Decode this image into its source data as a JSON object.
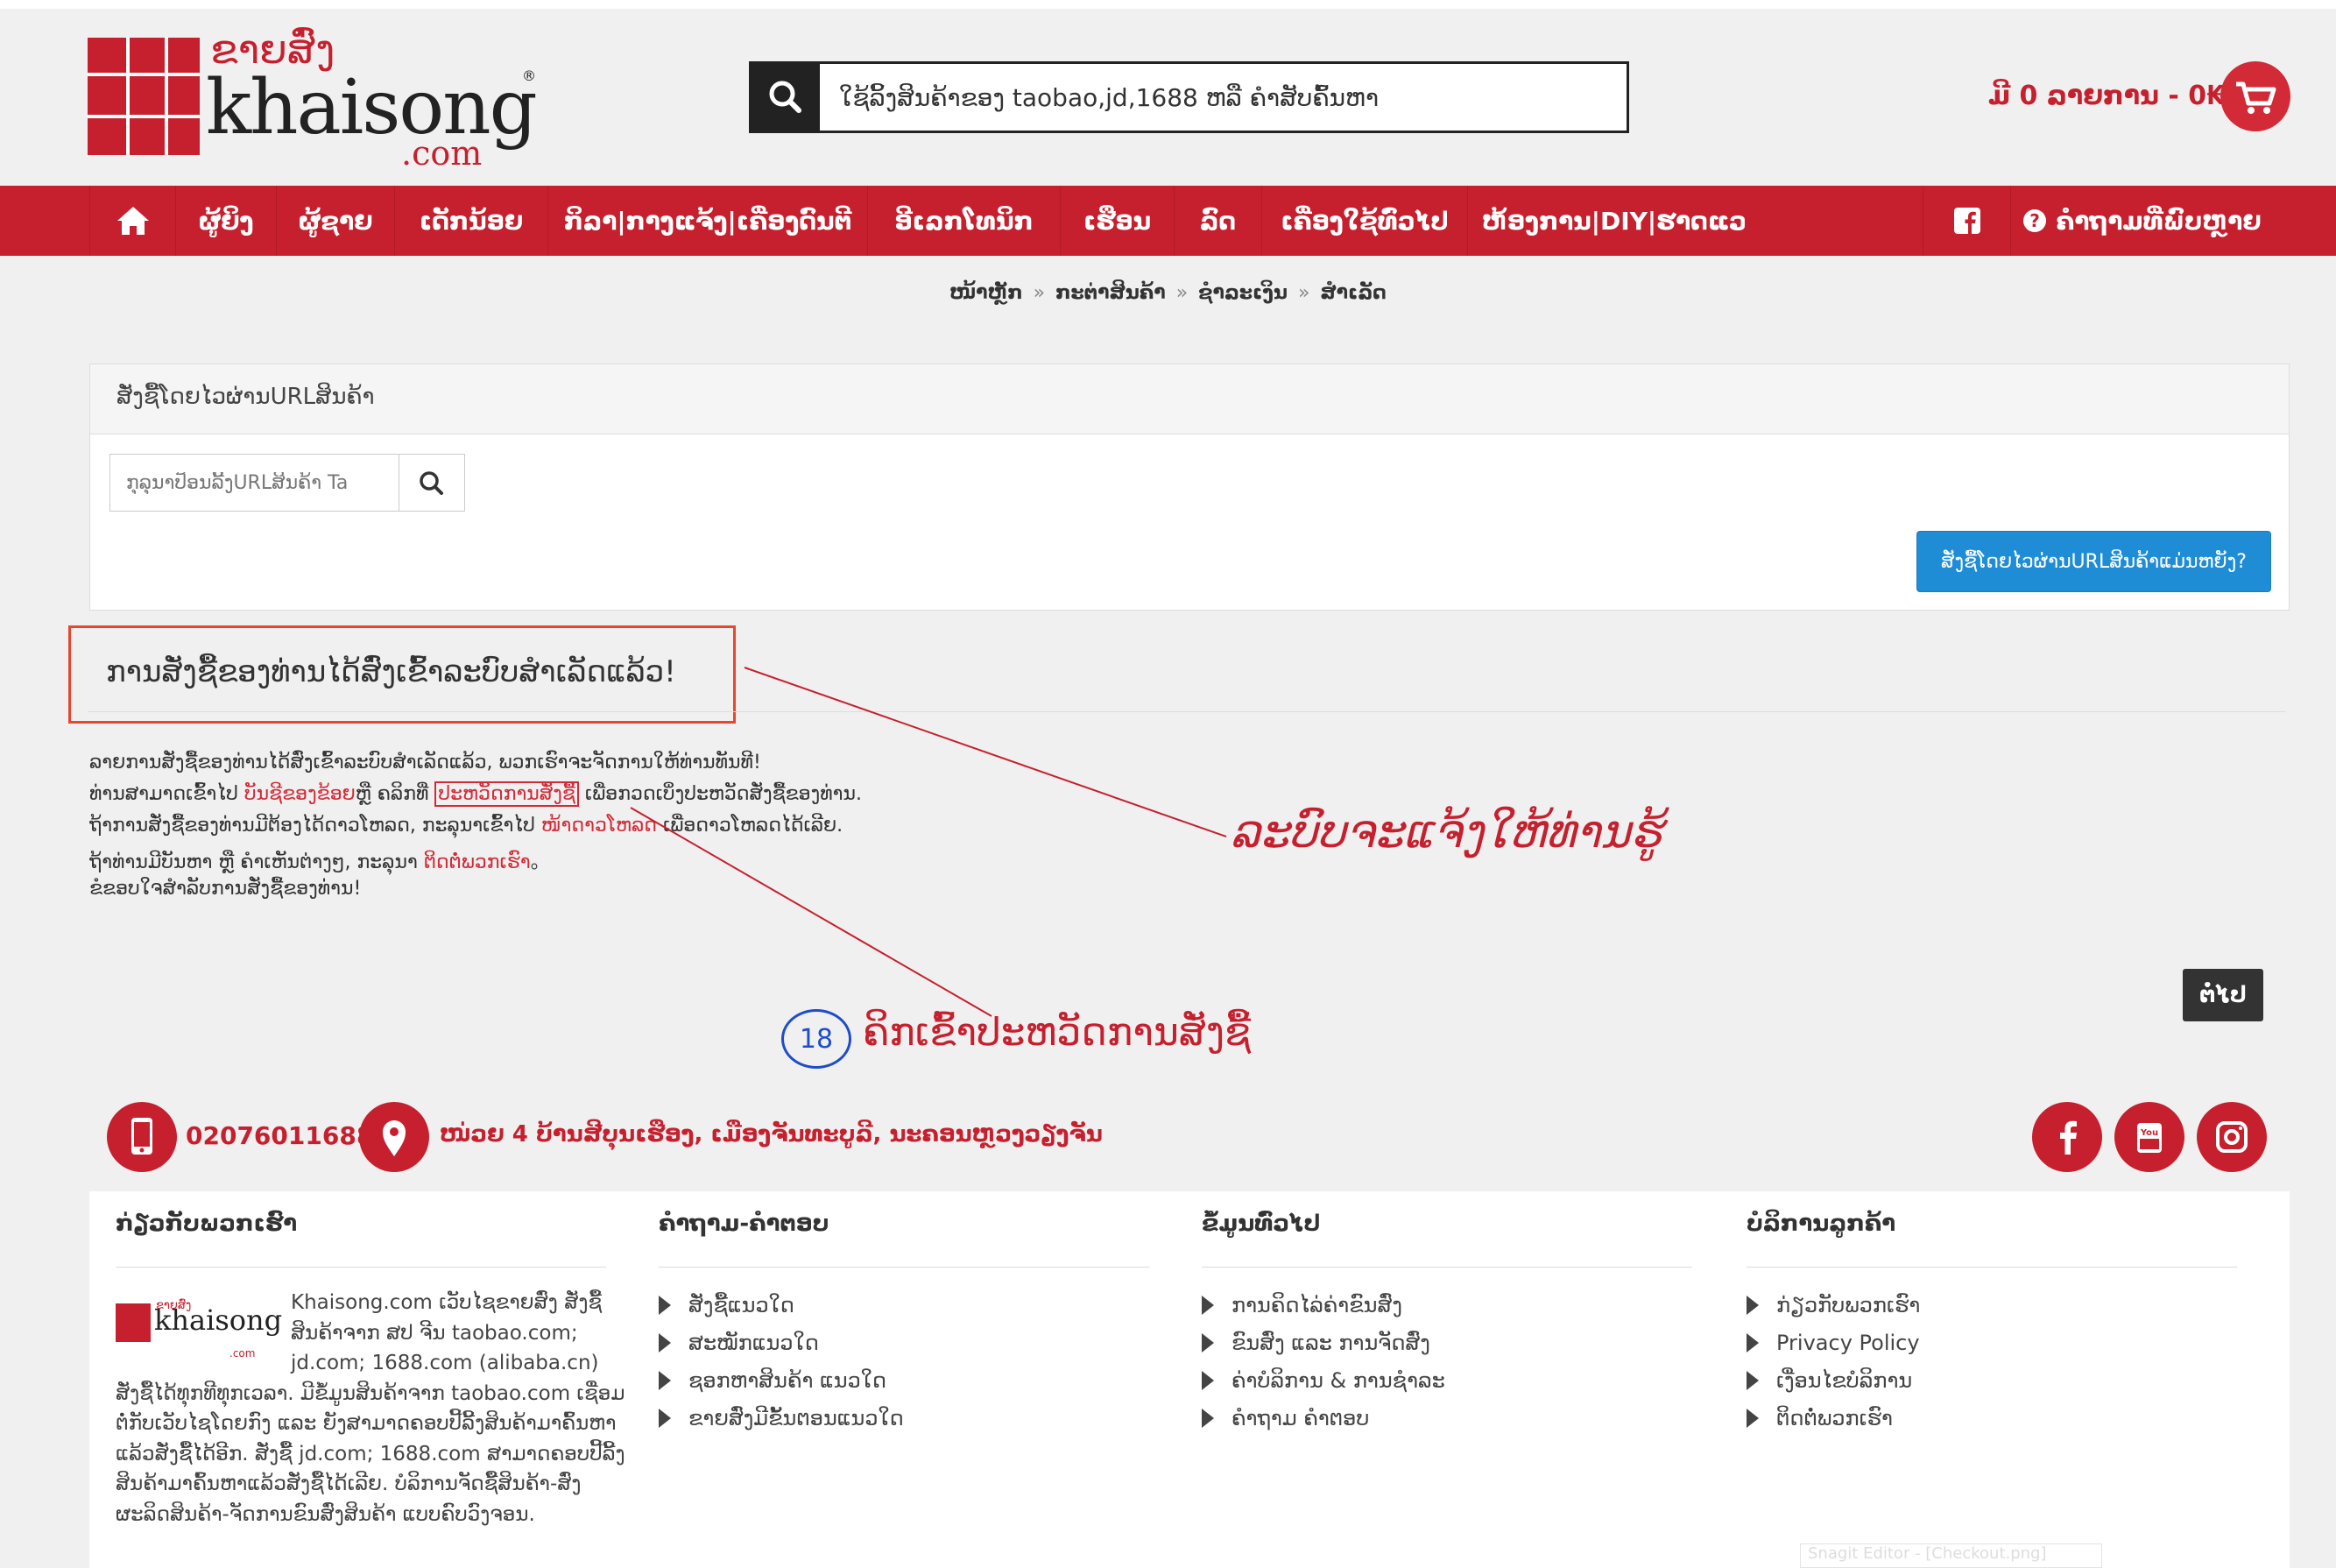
{
  "header": {
    "logo": {
      "lao": "ຂາຍສົ່ງ",
      "name": "khaisong",
      "suffix": ".com",
      "reg": "®"
    },
    "search": {
      "placeholder": "ໃຊ້ລິ້ງສິນຄ້າຂອງ taobao,jd,1688 ຫລື ຄຳສັບຄົ້ນຫາ"
    },
    "cart": {
      "text": "ມີ 0 ລາຍການ - 0₭"
    }
  },
  "nav": {
    "items": [
      "ຜູ້ຍິງ",
      "ຜູ້ຊາຍ",
      "ເດັກນ້ອຍ",
      "ກິລາ|ກາງແຈ້ງ|ເຄື່ອງດົນຕີ",
      "ອີເລກໂທນິກ",
      "ເຮືອນ",
      "ລົດ",
      "ເຄື່ອງໃຊ້ທົ່ວໄປ",
      "ຫ້ອງການ|DIY|ຮາດແວ"
    ],
    "faq": "ຄຳຖາມທີ່ພົບຫຼາຍ"
  },
  "breadcrumb": [
    "ໜ້າຫຼັກ",
    "ກະຕ່າສິນຄ້າ",
    "ຊຳລະເງິນ",
    "ສຳເລັດ"
  ],
  "url_panel": {
    "title": "ສັ່ງຊື້ໂດຍໄວຜ່ານURLສິນຄ້າ",
    "input_placeholder": "ກຸລຸນາປ້ອນລີ້ງURLສິນຄ້າ Ta",
    "help_button": "ສັ່ງຊື້ໂດຍໄວຜ່ານURLສິນຄ້າແມ່ນຫຍັງ?"
  },
  "success": {
    "title": "ການສັ່ງຊື້ຂອງທ່ານໄດ້ສົ່ງເຂົ້າລະບົບສຳເລັດແລ້ວ!",
    "line1": "ລາຍການສັ່ງຊື້ຂອງທ່ານໄດ້ສົ່ງເຂົ້າລະບົບສຳເລັດແລ້ວ, ພວກເຮົາຈະຈັດການໃຫ້ທ່ານທັນທີ!",
    "line2_a": "ທ່ານສາມາດເຂົ້າໄປ ",
    "line2_link1": "ບັນຊີຂອງຂ້ອຍ",
    "line2_b": "ຫຼື ຄລິກທີ່ ",
    "line2_link2": "ປະຫວັດການສັ່ງຊື້",
    "line2_c": " ເພື່ອກວດເບິ່ງປະຫວັດສັ່ງຊື້ຂອງທ່ານ.",
    "line3_a": "ຖ້າການສັ່ງຊື້ຂອງທ່ານມີຕ້ອງໄດ້ດາວໂຫລດ, ກະລຸນາເຂົ້າໄປ ",
    "line3_link": "ໜ້າດາວໂຫລດ",
    "line3_b": " ເພື່ອດາວໂຫລດໄດ້ເລີຍ.",
    "line4_a": "ຖ້າທ່ານມີບັນຫາ ຫຼື ຄຳເຫັນຕ່າງໆ, ກະລຸນາ ",
    "line4_link": "ຕິດຕໍ່ພວກເຮົາ",
    "line4_b": "。",
    "line5": "ຂໍຂອບໃຈສຳລັບການສັ່ງຊື້ຂອງທ່ານ!"
  },
  "annotations": {
    "note1": "ລະບົບຈະແຈ້ງໃຫ້ທ່ານຮູ້",
    "step_number": "18",
    "note2": "ຄິກເຂົ້າປະຫວັດການສັ່ງຊື້"
  },
  "next_button": "ຕໍ່ໄປ",
  "contact": {
    "phone": "02076011688",
    "address": "ໜ່ວຍ 4 ບ້ານສີບຸນເຮືອງ, ເມືອງຈັນທະບູລີ, ນະຄອນຫຼວງວຽງຈັນ"
  },
  "footer": {
    "about": {
      "heading": "ກ່ຽວກັບພວກເຮົາ",
      "text": "Khaisong.com ເວັບໄຊຂາຍສົ່ງ ສັ່ງຊື້ສິນຄ້າຈາກ ສປ ຈີນ taobao.com; jd.com; 1688.com (alibaba.cn) ສັ່ງຊື້ໄດ້ທຸກທີທຸກເວລາ. ມີຂໍ້ມູນສິນຄ້າຈາກ taobao.com ເຊື່ອມຕໍ່ກັບເວັບໄຊໂດຍກົງ ແລະ ຍັງສາມາດຄອບປີ້ລີ້ງສິນຄ້າມາຄົ້ນຫາແລ້ວສັ່ງຊື້ໄດ້ອີກ. ສັ່ງຊື້ jd.com; 1688.com ສາມາດຄອບປີ້ລີ້ງສິນຄ້າມາຄົ້ນຫາແລ້ວສັ່ງຊື້ໄດ້ເລີຍ. ບໍລິການຈັດຊື້ສິນຄ້າ-ສົ່ງຜະລິດສິນຄ້າ-ຈັດການຂົນສົ່ງສິນຄ້າ ແບບຄົບວົງຈອນ."
    },
    "faq": {
      "heading": "ຄຳຖາມ-ຄຳຕອບ",
      "links": [
        "ສັ່ງຊື້ແນວໃດ",
        "ສະໝັກແນວໃດ",
        "ຊອກຫາສິນຄ້າ ແນວໃດ",
        "ຂາຍສົ່ງມີຂັ້ນຕອນແນວໃດ"
      ]
    },
    "general": {
      "heading": "ຂໍ້ມູນທົ່ວໄປ",
      "links": [
        "ການຄິດໄລ່ຄ່າຂົນສົ່ງ",
        "ຂົນສົ່ງ ແລະ ການຈັດສົ່ງ",
        "ຄ່າບໍລິການ & ການຊຳລະ",
        "ຄຳຖາມ ຄຳຕອບ"
      ]
    },
    "service": {
      "heading": "ບໍລິການລູກຄ້າ",
      "links": [
        "ກ່ຽວກັບພວກເຮົາ",
        "Privacy Policy",
        "ເງື່ອນໄຂບໍລິການ",
        "ຕິດຕໍ່ພວກເຮົາ"
      ]
    }
  },
  "snagit_label": "Snagit Editor - [Checkout.png]",
  "colors": {
    "brand_red": "#c6202e",
    "button_blue": "#1f8dd6",
    "annotation_blue": "#1f4cc9"
  },
  "icons": [
    "search-icon",
    "cart-icon",
    "home-icon",
    "facebook-icon",
    "question-icon",
    "phone-icon",
    "location-icon",
    "youtube-icon",
    "instagram-icon",
    "triangle-right-icon"
  ]
}
